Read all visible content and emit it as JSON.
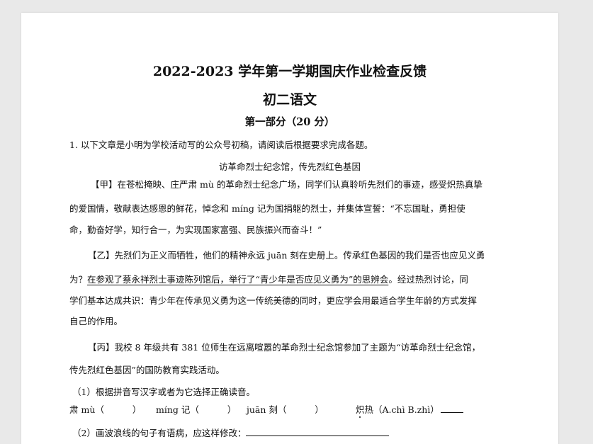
{
  "title": "2022-2023 学年第一学期国庆作业检查反馈",
  "subtitle": "初二语文",
  "part_heading": "第一部分（20 分）",
  "question_intro": "1. 以下文章是小明为学校活动写的公众号初稿，请阅读后根据要求完成各题。",
  "article_title": "访革命烈士纪念馆，传先烈红色基因",
  "para_jia": [
    "【甲】在苍松掩映、庄严肃 mù 的革命烈士纪念广场，同学们认真聆听先烈们的事迹，感受炽热真挚",
    "的爱国情，敬献表达感恩的鲜花，悼念和 míng 记为国捐躯的烈士，并集体宣誓：“不忘国耻，勇担使",
    "命，勤奋好学，知行合一，为实现国家富强、民族振兴而奋斗！”"
  ],
  "para_yi": {
    "line1": "【乙】先烈们为正义而牺牲，他们的精神永远 juān 刻在史册上。传承红色基因的我们是否也应见义勇",
    "line2_prefix": "为？",
    "line2_underlined": "在参观了蔡永祥烈士事迹陈列馆后，举行了“青少年是否应见义勇为”的思辨会",
    "line2_suffix": "。经过热烈讨论，同",
    "line3": "学们基本达成共识：青少年在传承见义勇为这一传统美德的同时，更应学会用最适合学生年龄的方式发挥",
    "line4": "自己的作用。"
  },
  "para_bing": [
    "【丙】我校 8 年级共有 381 位师生在远离喧嚣的革命烈士纪念馆参加了主题为“访革命烈士纪念馆，",
    "传先烈红色基因”的国防教育实践活动。"
  ],
  "sub_q1": "（1）根据拼音写汉字或者为它选择正确读音。",
  "q1_items": {
    "item1": "肃 mù（",
    "item1_close": "）",
    "item2": "míng 记（",
    "item2_close": "）",
    "item3": "juān 刻（",
    "item3_close": "）",
    "item4_prefix": "炽",
    "item4_suffix": "热（A.chì  B.zhì）"
  },
  "sub_q2": "（2）画波浪线的句子有语病，应这样修改："
}
